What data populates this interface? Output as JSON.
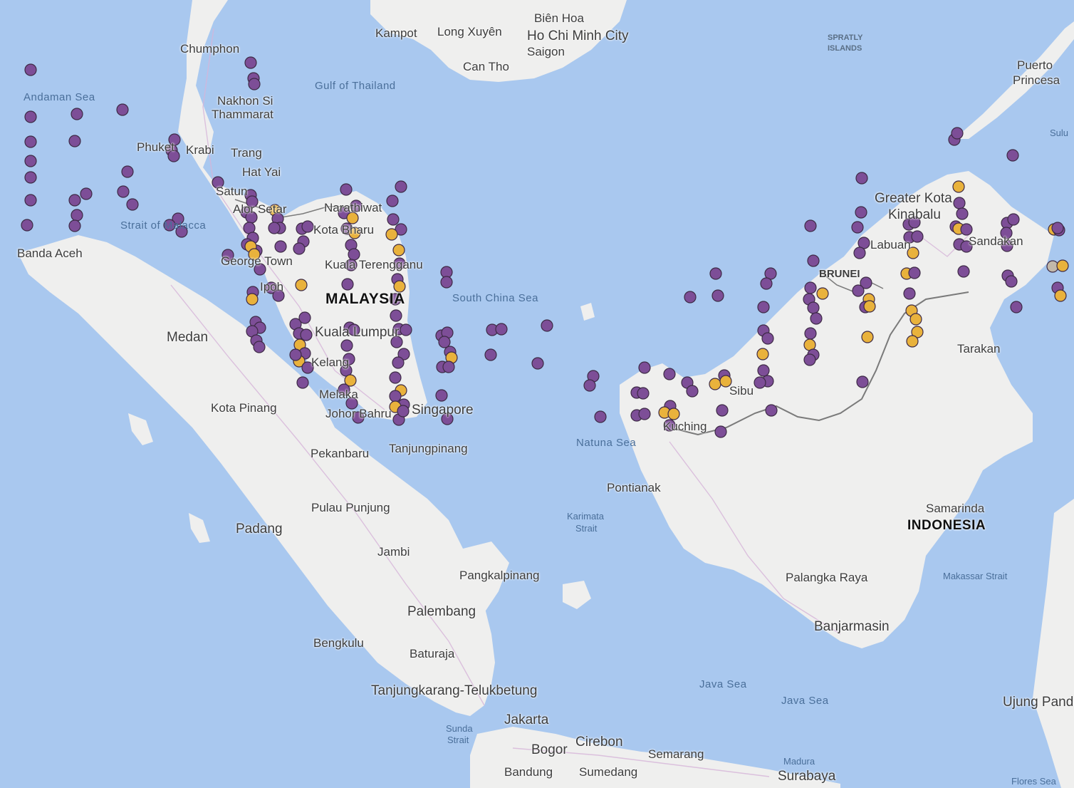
{
  "map": {
    "colors": {
      "water": "#a9c8ef",
      "land": "#efefee",
      "border": "#7a7a7a",
      "road": "#d6b4d8",
      "purple_marker": "#7d4e97",
      "yellow_marker": "#e9b23c",
      "gray_marker": "#c2b8aa"
    },
    "labels": {
      "bien_hoa": "Biên Hoa",
      "kampot": "Kampot",
      "long_xuyen": "Long Xuyên",
      "hcm": "Ho Chi Minh City",
      "saigon": "Saigon",
      "can_tho": "Can Tho",
      "spratly_1": "SPRATLY",
      "spratly_2": "ISLANDS",
      "puerto_1": "Puerto",
      "puerto_2": "Princesa",
      "sulu": "Sulu",
      "chumphon": "Chumphon",
      "andaman": "Andaman Sea",
      "gulf_thailand": "Gulf of Thailand",
      "nakhon_1": "Nakhon Si",
      "nakhon_2": "Thammarat",
      "phuket": "Phuket",
      "krabi": "Krabi",
      "trang": "Trang",
      "hat_yai": "Hat Yai",
      "satun": "Satun",
      "alor": "Alor Setar",
      "narathiwat": "Narathiwat",
      "kota_bharu": "Kota Bharu",
      "strait_malacca": "Strait of Malacca",
      "banda_aceh": "Banda Aceh",
      "george_town": "George Town",
      "kuala_terengganu": "Kuala Terengganu",
      "ipoh": "Ipoh",
      "malaysia": "MALAYSIA",
      "south_china_sea": "South China Sea",
      "medan": "Medan",
      "kuala_lumpur": "Kuala Lumpur",
      "kelang": "Kelang",
      "melaka": "Melaka",
      "kota_pinang": "Kota Pinang",
      "johor_bahru": "Johor Bahru",
      "singapore": "Singapore",
      "pekanbaru": "Pekanbaru",
      "tanjungpinang": "Tanjungpinang",
      "natuna": "Natuna Sea",
      "kuching": "Kuching",
      "sibu": "Sibu",
      "brunei": "BRUNEI",
      "labuan": "Labuan",
      "greater_kk_1": "Greater Kota",
      "greater_kk_2": "Kinabalu",
      "sandakan": "Sandakan",
      "tarakan": "Tarakan",
      "pontianak": "Pontianak",
      "pulau_punjung": "Pulau Punjung",
      "padang": "Padang",
      "karimata_1": "Karimata",
      "karimata_2": "Strait",
      "samarinda": "Samarinda",
      "indonesia": "INDONESIA",
      "jambi": "Jambi",
      "pangkalpinang": "Pangkalpinang",
      "makassar": "Makassar Strait",
      "palangka": "Palangka Raya",
      "palembang": "Palembang",
      "banjarmasin": "Banjarmasin",
      "bengkulu": "Bengkulu",
      "baturaja": "Baturaja",
      "java_sea_1": "Java Sea",
      "java_sea_2": "Java Sea",
      "tanjungkarang": "Tanjungkarang-Telukbetung",
      "ujung_pandang": "Ujung Pandang",
      "sunda_1": "Sunda",
      "sunda_2": "Strait",
      "jakarta": "Jakarta",
      "cirebon": "Cirebon",
      "bogor": "Bogor",
      "semarang": "Semarang",
      "bandung": "Bandung",
      "sumedang": "Sumedang",
      "madura": "Madura",
      "surabaya": "Surabaya",
      "flores": "Flores Sea"
    }
  }
}
